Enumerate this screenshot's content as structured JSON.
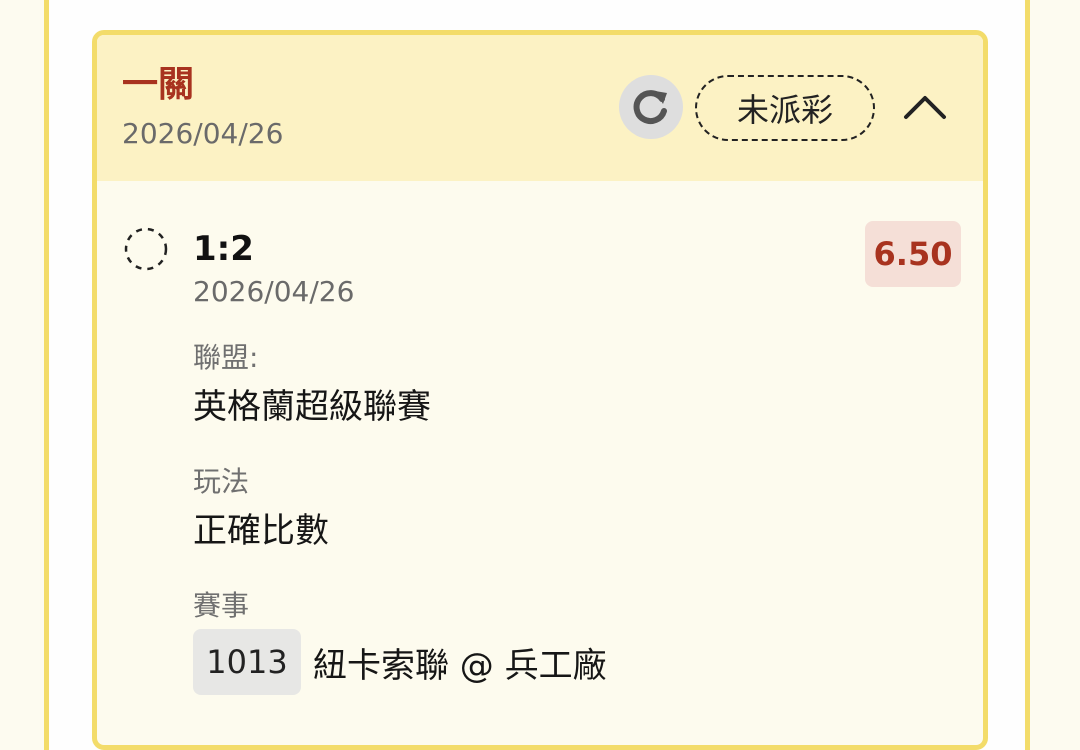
{
  "bet": {
    "type": "一關",
    "date": "2026/04/26",
    "status": "未派彩",
    "selection": {
      "score": "1:2",
      "date": "2026/04/26",
      "odds": "6.50",
      "league_label": "聯盟:",
      "league": "英格蘭超級聯賽",
      "bet_type_label": "玩法",
      "bet_type": "正確比數",
      "event_label": "賽事",
      "event_code": "1013",
      "event_name": "紐卡索聯 @ 兵工廠"
    }
  },
  "icons": {
    "refresh": "refresh-icon",
    "collapse": "chevron-up-icon",
    "pending": "pending-circle-icon"
  },
  "colors": {
    "accent_red": "#a8331f",
    "header_bg": "#fcf2c4",
    "card_border": "#f3dc6a",
    "odds_bg": "#f5dfd7"
  }
}
